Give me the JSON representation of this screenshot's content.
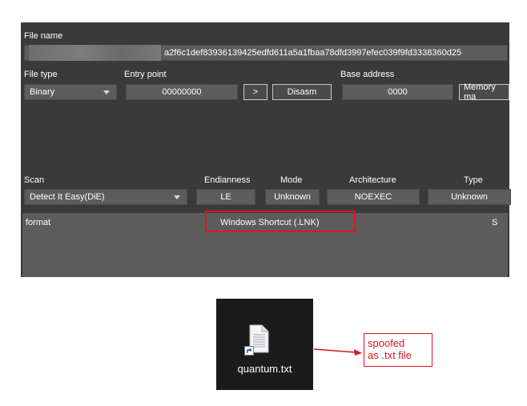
{
  "panel": {
    "file_name_label": "File name",
    "file_name_value": "a2f6c1def83936139425edfd611a5a1fbaa78dfd3997efec039f9fd3338360d25",
    "file_type_label": "File type",
    "file_type_value": "Binary",
    "entry_point_label": "Entry point",
    "entry_point_value": "00000000",
    "goto_button": ">",
    "disasm_button": "Disasm",
    "base_address_label": "Base address",
    "base_address_value": "0000",
    "memory_map_button": "Memory ma",
    "scan_label": "Scan",
    "scan_value": "Detect It Easy(DiE)",
    "endianness_label": "Endianness",
    "endianness_value": "LE",
    "mode_label": "Mode",
    "mode_value": "Unknown",
    "architecture_label": "Architecture",
    "architecture_value": "NOEXEC",
    "type_label": "Type",
    "type_value": "Unknown",
    "result_type": "format",
    "result_name": "Windows Shortcut (.LNK)",
    "result_flag": "S"
  },
  "desktop": {
    "file_label": "quantum.txt"
  },
  "callout": {
    "line1": "spoofed",
    "line2": "as .txt file"
  },
  "colors": {
    "highlight": "#e0141e",
    "panel_bg": "#3a3a3a",
    "field_bg": "#5c5c5c"
  },
  "icons": [
    "dropdown-arrow-icon",
    "text-file-icon",
    "shortcut-arrow-icon"
  ]
}
